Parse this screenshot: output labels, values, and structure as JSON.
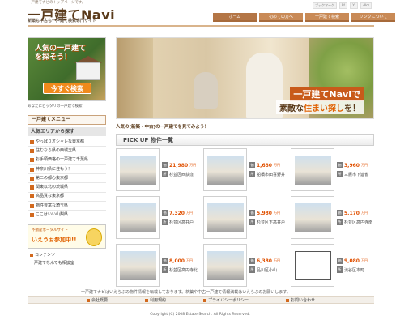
{
  "header": {
    "tagline": "一戸建てナビのトップページです。",
    "logo_main": "一戸建て",
    "logo_navi": "Navi",
    "subtitle": "新築も中古も一戸建て検索専門サイト",
    "icons": [
      "ブックマーク",
      "B!",
      "Y!",
      "dlcs"
    ],
    "nav": [
      "ホーム",
      "初めての方へ",
      "一戸建て検索",
      "リンクについて"
    ]
  },
  "sidebar": {
    "banner": {
      "title_line1": "人気の一戸建て",
      "title_line2": "を探そう！",
      "button": "今すぐ検索",
      "caption": "あなたにピッタリの一戸建て検索"
    },
    "menu_heading": "一戸建てメニュー",
    "area_heading": "人気エリアから探す",
    "items": [
      "やっぱりオシャレな東京都",
      "住むなら県の西城玉県",
      "お手頃価格の一戸建て千葉県",
      "神奈川県に住もう！",
      "第二の都心東京都",
      "関東以北の茨城県",
      "高品質な東京都",
      "物件豊富な埼玉県",
      "ここはいい山梨県"
    ],
    "portal": {
      "line1": "不動産ポータルサイト",
      "line2": "いえうぉ参加中!!"
    },
    "bottom_links": [
      "コンテンツ",
      "一戸建てなんでも相談室"
    ]
  },
  "hero": {
    "title": "一戸建てNaviで",
    "sub_prefix": "素敵な",
    "sub_accent": "住まい探し",
    "sub_suffix": "を！"
  },
  "main": {
    "lead": "人気の[新築・中古]の一戸建てを見てみよう！",
    "pickup_title": "PICK UP 物件一覧",
    "label_price": "価格",
    "label_loc": "所在",
    "properties": [
      {
        "price": "21,980",
        "unit": "万円",
        "loc": "杉並区西荻窪"
      },
      {
        "price": "1,680",
        "unit": "万円",
        "loc": "船橋市田喜野井"
      },
      {
        "price": "3,960",
        "unit": "万円",
        "loc": "三鷹市下連雀"
      },
      {
        "price": "7,320",
        "unit": "万円",
        "loc": "杉並区高井戸"
      },
      {
        "price": "5,980",
        "unit": "万円",
        "loc": "杉並区下高井戸"
      },
      {
        "price": "5,170",
        "unit": "万円",
        "loc": "杉並区高円寺南"
      },
      {
        "price": "8,000",
        "unit": "万円",
        "loc": "杉並区高円寺北"
      },
      {
        "price": "6,380",
        "unit": "万円",
        "loc": "品川区小山"
      },
      {
        "price": "9,080",
        "unit": "万円",
        "loc": "渋谷区本町"
      }
    ]
  },
  "footer": {
    "note": "一戸建てナビはいえらぶの物件情報を転載しております。新築や中古一戸建て情報満載はいえらぶのお願いします。",
    "links": [
      "会社概要",
      "利用規約",
      "プライバシーポリシー",
      "お問い合わせ"
    ],
    "copyright": "Copyright (C) 2008 Estate-Search. All Rights Reserved."
  }
}
